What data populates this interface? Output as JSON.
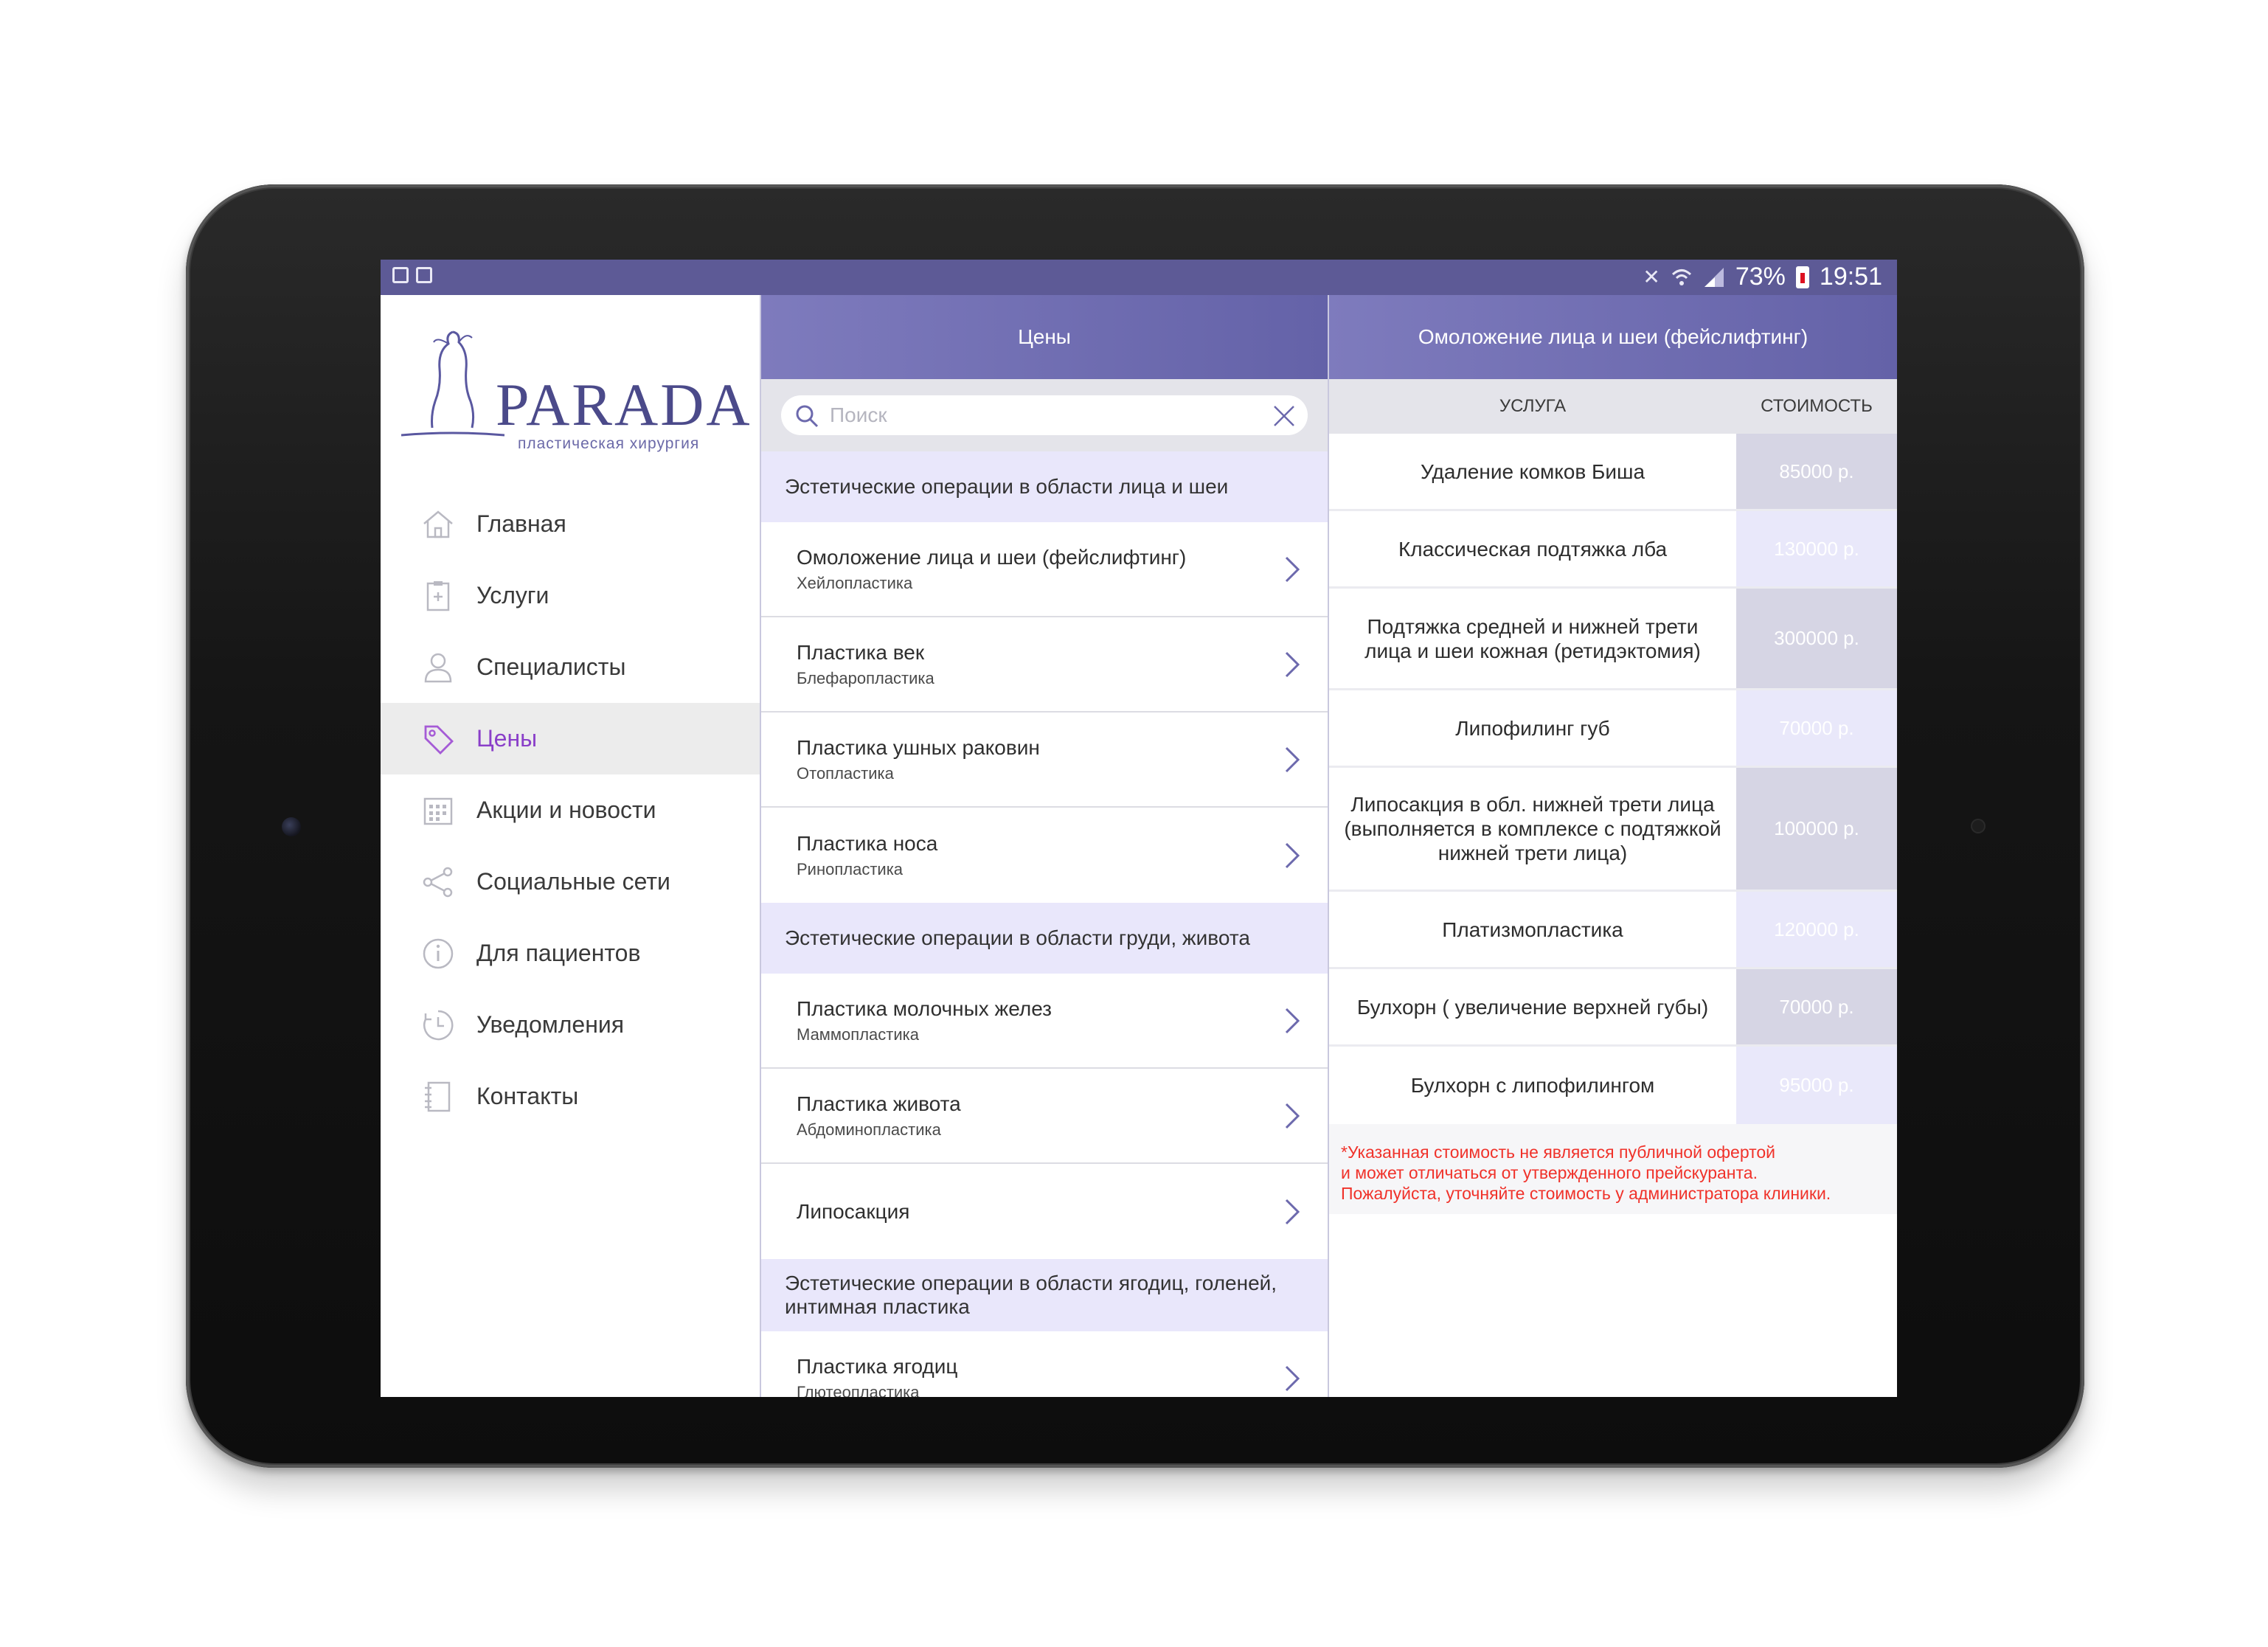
{
  "status_bar": {
    "battery": "73%",
    "time": "19:51"
  },
  "brand": {
    "name": "PARADA",
    "tagline": "пластическая хирургия"
  },
  "nav": {
    "items": [
      {
        "label": "Главная",
        "icon": "home-icon",
        "active": false
      },
      {
        "label": "Услуги",
        "icon": "clipboard-icon",
        "active": false
      },
      {
        "label": "Специалисты",
        "icon": "person-icon",
        "active": false
      },
      {
        "label": "Цены",
        "icon": "price-tag-icon",
        "active": true
      },
      {
        "label": "Акции и новости",
        "icon": "calendar-icon",
        "active": false
      },
      {
        "label": "Социальные сети",
        "icon": "share-icon",
        "active": false
      },
      {
        "label": "Для пациентов",
        "icon": "info-icon",
        "active": false
      },
      {
        "label": "Уведомления",
        "icon": "clock-icon",
        "active": false
      },
      {
        "label": "Контакты",
        "icon": "notebook-icon",
        "active": false
      }
    ]
  },
  "prices_panel": {
    "title": "Цены",
    "search_placeholder": "Поиск",
    "sections": [
      {
        "title": "Эстетические операции в области лица и шеи",
        "items": [
          {
            "title": "Омоложение лица и шеи (фейслифтинг)",
            "subtitle": "Хейлопластика"
          },
          {
            "title": "Пластика век",
            "subtitle": "Блефаропластика"
          },
          {
            "title": "Пластика ушных раковин",
            "subtitle": "Отопластика"
          },
          {
            "title": "Пластика носа",
            "subtitle": "Ринопластика"
          }
        ]
      },
      {
        "title": "Эстетические операции в области груди, живота",
        "items": [
          {
            "title": "Пластика молочных желез",
            "subtitle": "Маммопластика"
          },
          {
            "title": "Пластика живота",
            "subtitle": "Абдоминопластика"
          },
          {
            "title": "Липосакция",
            "subtitle": ""
          }
        ]
      },
      {
        "title": "Эстетические операции в области ягодиц, голеней, интимная пластика",
        "items": [
          {
            "title": "Пластика ягодиц",
            "subtitle": "Глютеопластика"
          }
        ]
      }
    ]
  },
  "detail_panel": {
    "title": "Омоложение лица и шеи (фейслифтинг)",
    "col_service": "УСЛУГА",
    "col_price": "СТОИМОСТЬ",
    "rows": [
      {
        "service": "Удаление комков Биша",
        "price": "85000 р."
      },
      {
        "service": "Классическая подтяжка лба",
        "price": "130000 р."
      },
      {
        "service": "Подтяжка средней и нижней трети лица и шеи кожная (ретидэктомия)",
        "price": "300000  р."
      },
      {
        "service": "Липофилинг губ",
        "price": "70000 р."
      },
      {
        "service": "Липосакция в обл. нижней трети лица (выполняется в комплексе с подтяжкой нижней трети лица)",
        "price": "100000 р."
      },
      {
        "service": "Платизмопластика",
        "price": "120000 р."
      },
      {
        "service": "Булхорн ( увеличение верхней губы)",
        "price": "70000 р."
      },
      {
        "service": "Булхорн с липофилингом",
        "price": "95000 р."
      }
    ],
    "note_lines": [
      "*Указанная стоимость не является публичной офертой",
      "и может отличаться от утвержденного прейскуранта.",
      "Пожалуйста, уточняйте стоимость у администратора клиники."
    ]
  },
  "colors": {
    "header": "#6c69ad",
    "status_bar": "#5d5a96",
    "accent": "#8a3fc9",
    "section_bg": "#e9e7fb",
    "note_text": "#f0322a"
  }
}
